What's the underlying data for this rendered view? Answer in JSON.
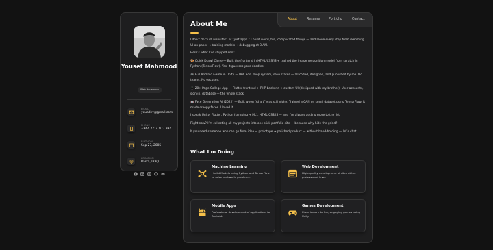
{
  "sidebar": {
    "name": "Yousef Mahmood",
    "role": "Web developer",
    "contacts": [
      {
        "title": "EMAIL",
        "value": "youadev@gmail.com",
        "icon": "mail-icon"
      },
      {
        "title": "PHONE",
        "value": "+964 7714 977 997",
        "icon": "phone-icon"
      },
      {
        "title": "BIRTHDAY",
        "value": "Sep 27, 2005",
        "icon": "calendar-icon"
      },
      {
        "title": "LOCATION",
        "value": "Basra, IRAQ",
        "icon": "location-pin-icon"
      }
    ],
    "socials": [
      "facebook-icon",
      "linkedin-icon",
      "instagram-icon",
      "github-icon",
      "discord-icon"
    ]
  },
  "nav": {
    "items": [
      "About",
      "Resume",
      "Portfolio",
      "Contact"
    ],
    "active": "About"
  },
  "main": {
    "title": "About Me",
    "paragraphs": [
      "I don’t do “just websites” or “just apps.” I build weird, fun, complicated things — and I love every step from sketching UI on paper → training models → debugging at 3 AM.",
      "Here’s what I’ve shipped solo:",
      "🎨 Quick Draw! Clone — Built the frontend in HTML/CSS/JS + trained the image recognition model from scratch in Python (TensorFlow). Yes, it guesses your doodles.",
      "🎮 Full Android Game in Unity — IAP, ads, shop system, save states — all coded, designed, and published by me. No teams. No excuses.",
      "📱 20+ Page College App — Flutter frontend + PHP backend + custom UI (designed with my brother). User accounts, sign-in, database — the whole stack.",
      "🤖 Face Generation AI (2022) — Built when “AI art” was still niche. Trained a GAN on small dataset using TensorFlow. It made creepy faces. I loved it.",
      "I speak Unity, Flutter, Python (scraping + ML), HTML/CSS/JS — and I’m always adding more to the list.",
      "Right now? I’m collecting all my projects into one slick portfolio site — because why hide the grind?",
      "If you need someone who can go from idea → prototype → polished product — without hand-holding — let’s chat."
    ],
    "services_title": "What I'm Doing",
    "services": [
      {
        "title": "Machine Learning",
        "text": "I build Models using Python and TensorFlow to solve real-world problems.",
        "icon": "neural-network-icon"
      },
      {
        "title": "Web Development",
        "text": "High-quality development of sites at the professional level.",
        "icon": "browser-window-icon"
      },
      {
        "title": "Mobile Apps",
        "text": "Professional development of applications for Android.",
        "icon": "android-icon"
      },
      {
        "title": "Games Development",
        "text": "I turn ideas into fun, engaging games using Unity.",
        "icon": "gamepad-icon"
      }
    ]
  },
  "colors": {
    "accent": "#f5c04a",
    "background": "#121212",
    "card": "#1e1e1f",
    "border": "#383838"
  }
}
